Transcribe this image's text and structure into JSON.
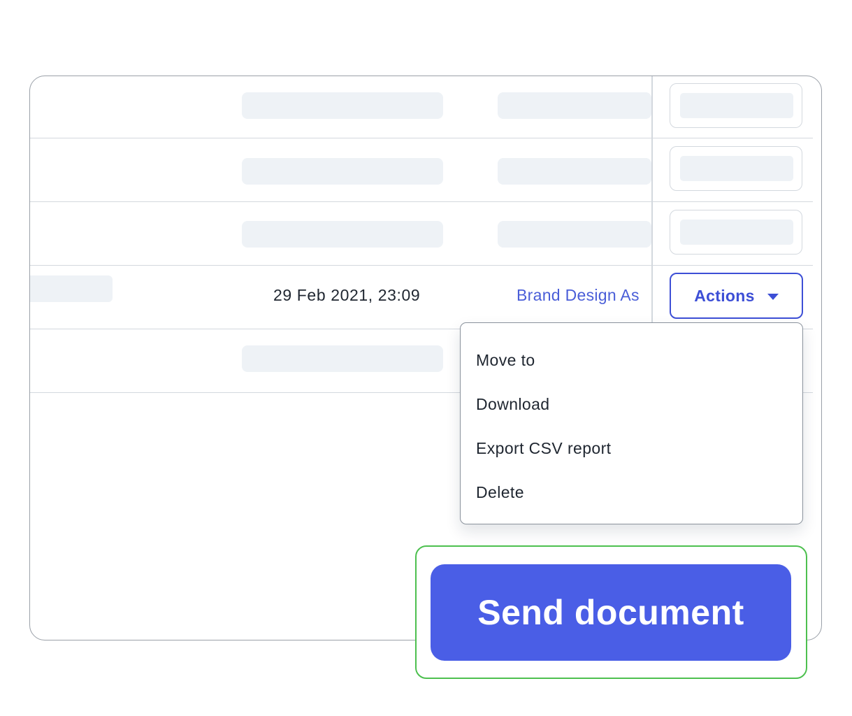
{
  "table": {
    "highlight_row": {
      "date": "29 Feb 2021, 23:09",
      "folder": "Brand Design As"
    },
    "actions_button": {
      "label": "Actions",
      "icon": "caret-down-icon"
    }
  },
  "actions_menu": {
    "items": [
      {
        "label": "Move to"
      },
      {
        "label": "Download"
      },
      {
        "label": "Export CSV report"
      },
      {
        "label": "Delete"
      }
    ]
  },
  "send_button": {
    "label": "Send document",
    "color": "#4a5ee6",
    "highlight_color": "#4dc04f"
  },
  "colors": {
    "accent": "#3d4fd6",
    "skeleton": "#eef2f6",
    "border": "#d3d8de"
  }
}
